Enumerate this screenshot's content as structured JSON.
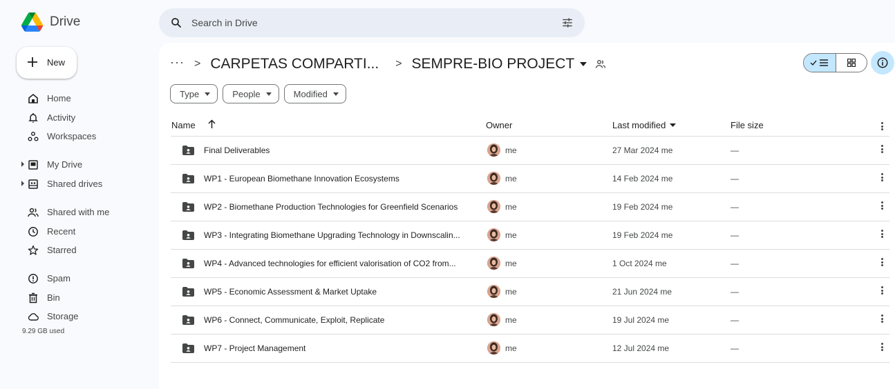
{
  "app": {
    "name": "Drive"
  },
  "search": {
    "placeholder": "Search in Drive"
  },
  "sidebar": {
    "new_label": "New",
    "items": [
      {
        "label": "Home",
        "icon": "home-icon"
      },
      {
        "label": "Activity",
        "icon": "bell-icon"
      },
      {
        "label": "Workspaces",
        "icon": "workspaces-icon"
      },
      {
        "label": "My Drive",
        "icon": "my-drive-icon"
      },
      {
        "label": "Shared drives",
        "icon": "shared-drives-icon"
      },
      {
        "label": "Shared with me",
        "icon": "people-icon"
      },
      {
        "label": "Recent",
        "icon": "clock-icon"
      },
      {
        "label": "Starred",
        "icon": "star-icon"
      },
      {
        "label": "Spam",
        "icon": "spam-icon"
      },
      {
        "label": "Bin",
        "icon": "trash-icon"
      },
      {
        "label": "Storage",
        "icon": "cloud-icon"
      }
    ],
    "storage_used": "9.29 GB used"
  },
  "breadcrumb": {
    "overflow": "···",
    "parent": "CARPETAS COMPARTI...",
    "current": "SEMPRE-BIO PROJECT"
  },
  "filters": [
    {
      "label": "Type"
    },
    {
      "label": "People"
    },
    {
      "label": "Modified"
    }
  ],
  "table": {
    "columns": {
      "name": "Name",
      "owner": "Owner",
      "modified": "Last modified",
      "size": "File size"
    },
    "rows": [
      {
        "name": "Final Deliverables",
        "owner": "me",
        "modified": "27 Mar 2024 me",
        "size": "—"
      },
      {
        "name": "WP1 - European Biomethane Innovation Ecosystems",
        "owner": "me",
        "modified": "14 Feb 2024 me",
        "size": "—"
      },
      {
        "name": "WP2 - Biomethane Production Technologies for Greenfield Scenarios",
        "owner": "me",
        "modified": "19 Feb 2024 me",
        "size": "—"
      },
      {
        "name": "WP3 - Integrating Biomethane Upgrading Technology in Downscalin...",
        "owner": "me",
        "modified": "19 Feb 2024 me",
        "size": "—"
      },
      {
        "name": "WP4 - Advanced technologies for efficient valorisation of CO2 from...",
        "owner": "me",
        "modified": "1 Oct 2024 me",
        "size": "—"
      },
      {
        "name": "WP5 - Economic Assessment & Market Uptake",
        "owner": "me",
        "modified": "21 Jun 2024 me",
        "size": "—"
      },
      {
        "name": "WP6 - Connect, Communicate, Exploit, Replicate",
        "owner": "me",
        "modified": "19 Jul 2024 me",
        "size": "—"
      },
      {
        "name": "WP7 - Project Management",
        "owner": "me",
        "modified": "12 Jul 2024 me",
        "size": "—"
      }
    ]
  },
  "colors": {
    "accent": "#c2e7ff",
    "page_bg": "#f8fafd",
    "search_bg": "#e9eef6"
  }
}
